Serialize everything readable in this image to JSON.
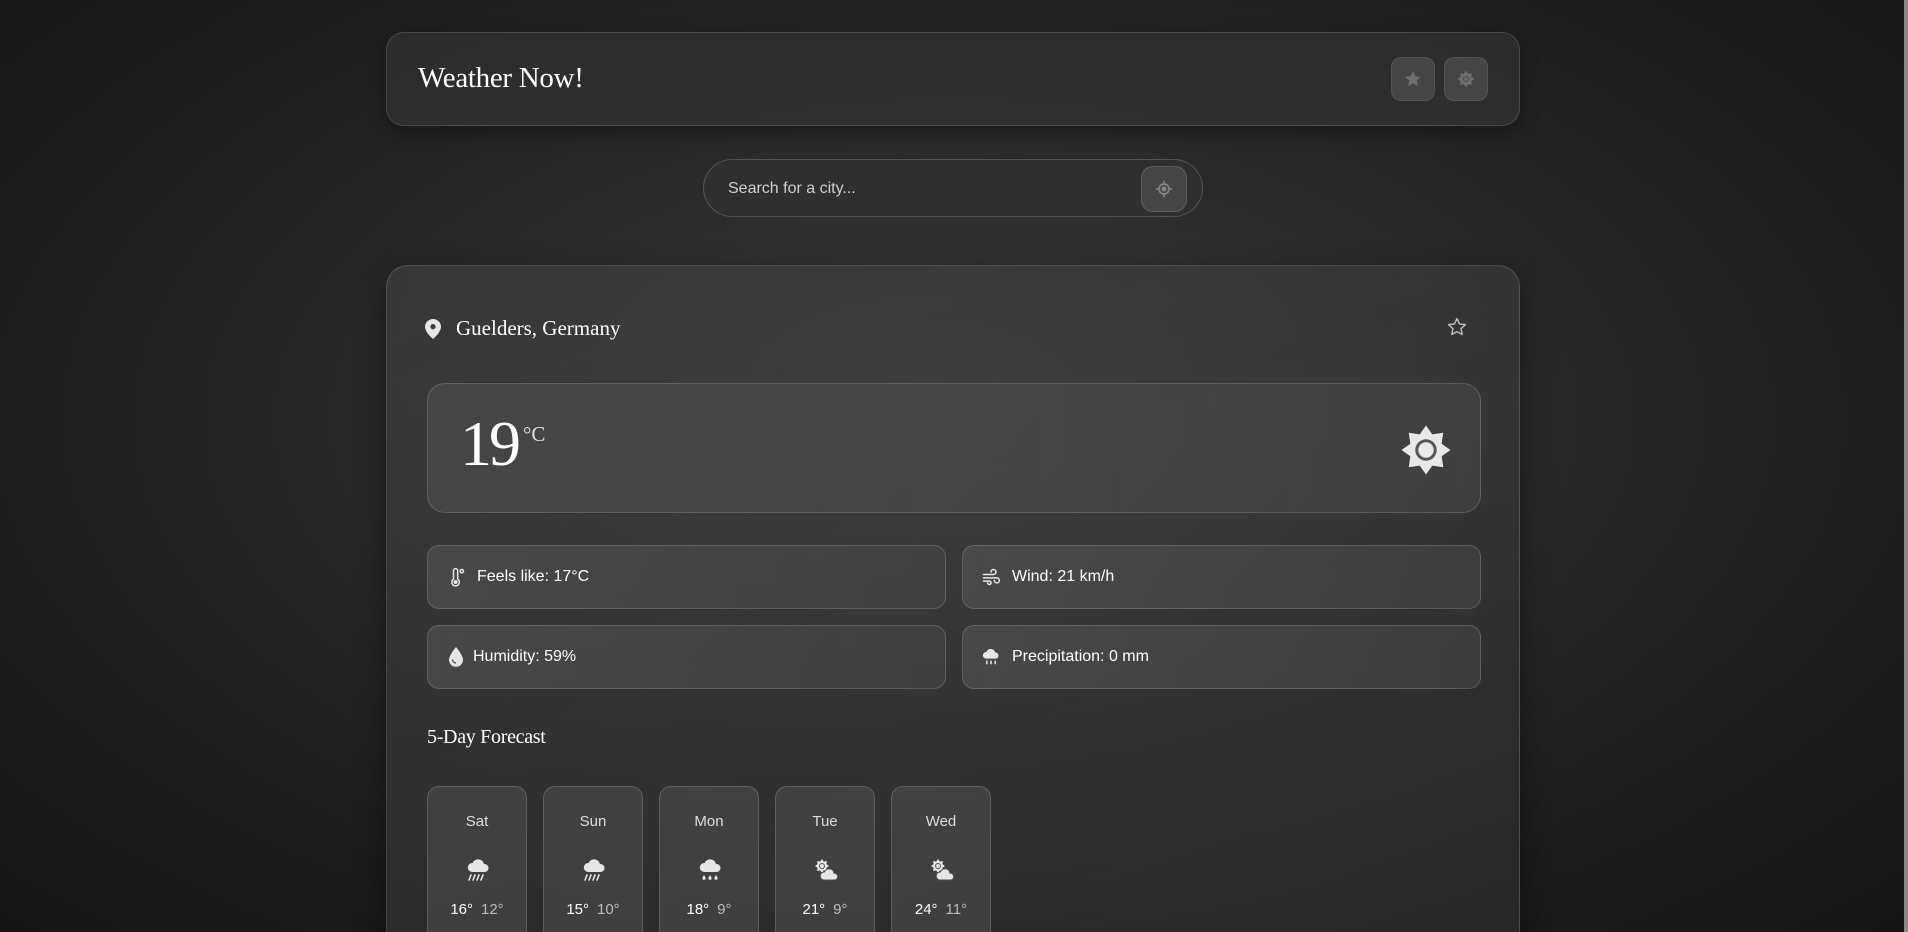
{
  "header": {
    "title": "Weather Now!",
    "favorites_icon": "star-filled-icon",
    "theme_icon": "sun-icon"
  },
  "search": {
    "placeholder": "Search for a city...",
    "locate_icon": "crosshair-icon"
  },
  "location": {
    "name": "Guelders, Germany",
    "pin_icon": "map-pin-icon",
    "favorite_icon": "star-outline-icon"
  },
  "current": {
    "temperature": "19",
    "unit": "°C",
    "condition_icon": "sun-icon"
  },
  "details": {
    "feels_like": "Feels like: 17°C",
    "wind": "Wind: 21 km/h",
    "humidity": "Humidity: 59%",
    "precipitation": "Precipitation: 0 mm"
  },
  "forecast": {
    "title": "5-Day Forecast",
    "days": [
      {
        "day": "Sat",
        "high": "16°",
        "low": "12°",
        "icon": "rain-icon"
      },
      {
        "day": "Sun",
        "high": "15°",
        "low": "10°",
        "icon": "rain-icon"
      },
      {
        "day": "Mon",
        "high": "18°",
        "low": "9°",
        "icon": "showers-icon"
      },
      {
        "day": "Tue",
        "high": "21°",
        "low": "9°",
        "icon": "partly-cloudy-icon"
      },
      {
        "day": "Wed",
        "high": "24°",
        "low": "11°",
        "icon": "partly-cloudy-icon"
      }
    ]
  },
  "colors": {
    "background": "#1c1c1c",
    "card": "#404040",
    "text": "#ffffff",
    "muted_text": "#bbbbbb"
  }
}
